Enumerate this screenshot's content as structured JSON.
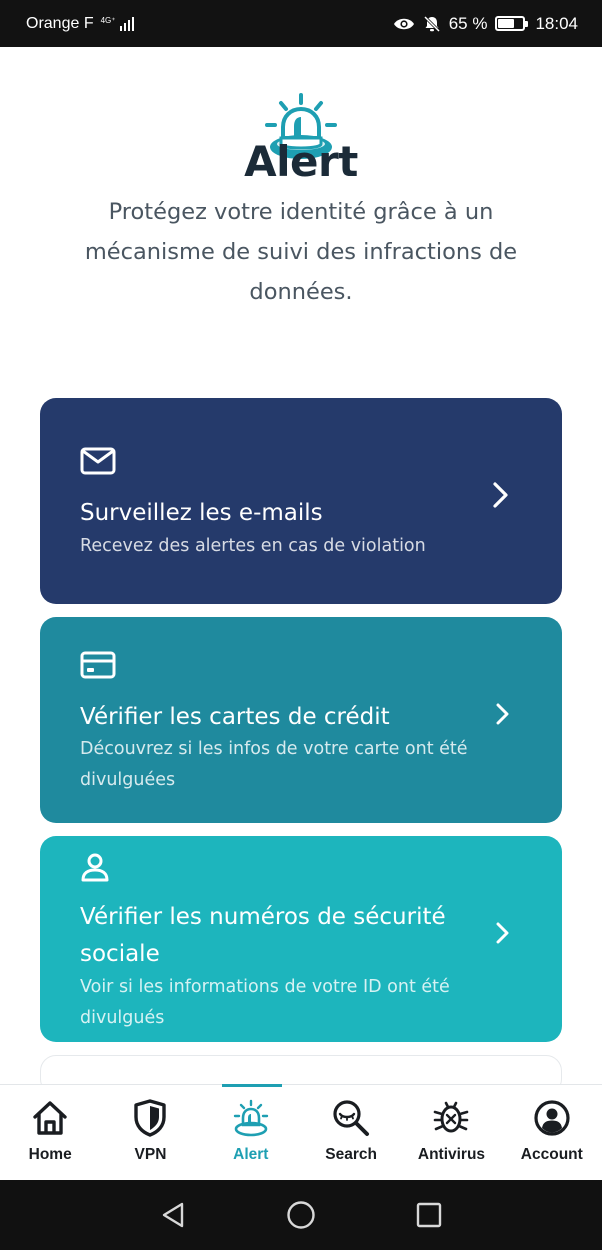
{
  "status_bar": {
    "carrier": "Orange F",
    "network_type": "4G⁺",
    "signal_bars": 4,
    "battery_percent": "65 %",
    "battery_level": 0.65,
    "time": "18:04",
    "icons": [
      "eye-icon",
      "bell-off-icon",
      "battery-icon"
    ]
  },
  "header": {
    "icon": "alarm-siren-icon",
    "title": "Alert",
    "subtitle": "Protégez votre identité grâce à un mécanisme de suivi des infractions de données."
  },
  "cards": [
    {
      "icon": "envelope-icon",
      "title": "Surveillez les e-mails",
      "description": "Recevez des alertes en cas de violation",
      "color": "#253a6b"
    },
    {
      "icon": "credit-card-icon",
      "title": "Vérifier les cartes de crédit",
      "description": "Découvrez si les infos de votre carte ont été divulguées",
      "color": "#1f8a9e"
    },
    {
      "icon": "person-icon",
      "title": "Vérifier les numéros de sécurité sociale",
      "description": "Voir si les informations de votre ID ont été divulgués",
      "color": "#1db5bd"
    }
  ],
  "bottom_nav": {
    "active": "Alert",
    "accent_color": "#1e9fb2",
    "items": [
      {
        "label": "Home",
        "icon": "home-icon"
      },
      {
        "label": "VPN",
        "icon": "shield-icon"
      },
      {
        "label": "Alert",
        "icon": "alarm-siren-icon"
      },
      {
        "label": "Search",
        "icon": "search-eye-icon"
      },
      {
        "label": "Antivirus",
        "icon": "bug-icon"
      },
      {
        "label": "Account",
        "icon": "account-icon"
      }
    ]
  },
  "system_nav": {
    "buttons": [
      "back-icon",
      "home-circle-icon",
      "recents-icon"
    ]
  }
}
